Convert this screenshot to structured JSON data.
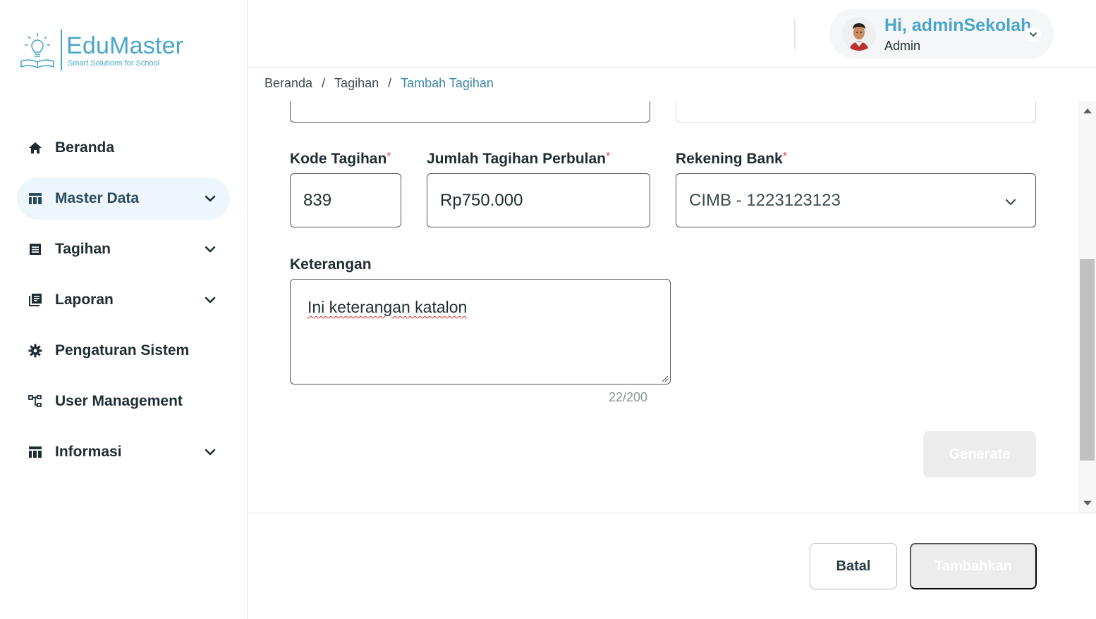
{
  "brand": {
    "name": "EduMaster",
    "tagline": "Smart Solutions for School",
    "color": "#4aa6c9"
  },
  "sidebar": {
    "items": [
      {
        "label": "Beranda",
        "icon": "home-icon",
        "has_submenu": false,
        "active": false
      },
      {
        "label": "Master Data",
        "icon": "table-icon",
        "has_submenu": true,
        "active": true
      },
      {
        "label": "Tagihan",
        "icon": "list-icon",
        "has_submenu": true,
        "active": false
      },
      {
        "label": "Laporan",
        "icon": "library-icon",
        "has_submenu": true,
        "active": false
      },
      {
        "label": "Pengaturan Sistem",
        "icon": "gear-icon",
        "has_submenu": false,
        "active": false
      },
      {
        "label": "User Management",
        "icon": "hierarchy-icon",
        "has_submenu": false,
        "active": false
      },
      {
        "label": "Informasi",
        "icon": "table-icon",
        "has_submenu": true,
        "active": false
      }
    ]
  },
  "header": {
    "greeting": "Hi, adminSekolah",
    "role": "Admin"
  },
  "breadcrumb": {
    "items": [
      "Beranda",
      "Tagihan",
      "Tambah Tagihan"
    ]
  },
  "form": {
    "kode_tagihan": {
      "label": "Kode Tagihan",
      "required_mark": "*",
      "value": "839"
    },
    "jumlah_tagihan": {
      "label": "Jumlah Tagihan Perbulan",
      "required_mark": "*",
      "value": "Rp750.000"
    },
    "rekening_bank": {
      "label": "Rekening Bank",
      "required_mark": "*",
      "value": "CIMB - 1223123123"
    },
    "keterangan": {
      "label": "Keterangan",
      "value": "Ini keterangan katalon",
      "counter": "22/200"
    },
    "generate_label": "Generate"
  },
  "footer": {
    "cancel_label": "Batal",
    "submit_label": "Tambahkan"
  },
  "colors": {
    "accent": "#4aa6c9",
    "breadcrumb_current": "#3f87a8",
    "required": "#e23c3c",
    "disabled_button": "#ececec"
  }
}
